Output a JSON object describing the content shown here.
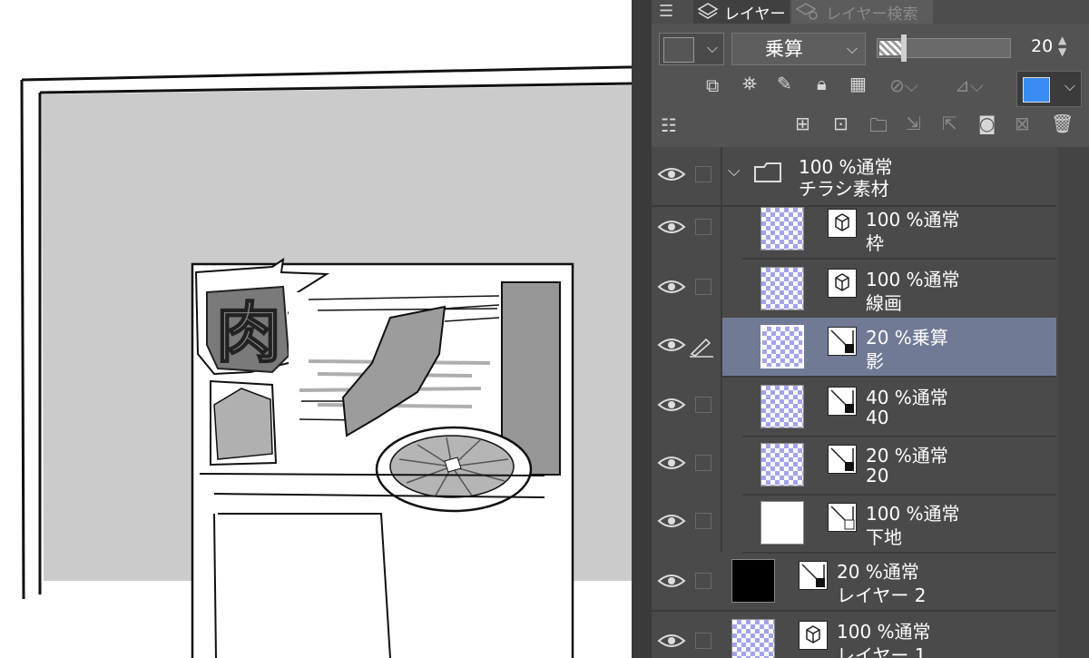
{
  "panel": {
    "tabs": [
      {
        "label": "レイヤー",
        "icon": "layers-icon"
      },
      {
        "label": "レイヤー検索",
        "icon": "layer-search-icon"
      }
    ],
    "blend_mode": "乗算",
    "opacity": "20",
    "opacity_fraction": 0.2,
    "accent_color": "#3a8cf5",
    "selected_row_color": "#717a95"
  },
  "layers": [
    {
      "opacity": "100 %通常",
      "name": "チラシ素材",
      "type": "folder"
    },
    {
      "opacity": "100 %通常",
      "name": "枠",
      "type": "vector"
    },
    {
      "opacity": "100 %通常",
      "name": "線画",
      "type": "vector"
    },
    {
      "opacity": "20 %乗算",
      "name": "影",
      "type": "raster",
      "selected": true
    },
    {
      "opacity": "40 %通常",
      "name": "40",
      "type": "raster"
    },
    {
      "opacity": "20 %通常",
      "name": "20",
      "type": "raster"
    },
    {
      "opacity": "100 %通常",
      "name": "下地",
      "type": "raster"
    },
    {
      "opacity": "20 %通常",
      "name": "レイヤー 2",
      "type": "raster"
    },
    {
      "opacity": "100 %通常",
      "name": "レイヤー 1",
      "type": "vector"
    }
  ],
  "canvas": {
    "flyer_glyph": "肉"
  }
}
